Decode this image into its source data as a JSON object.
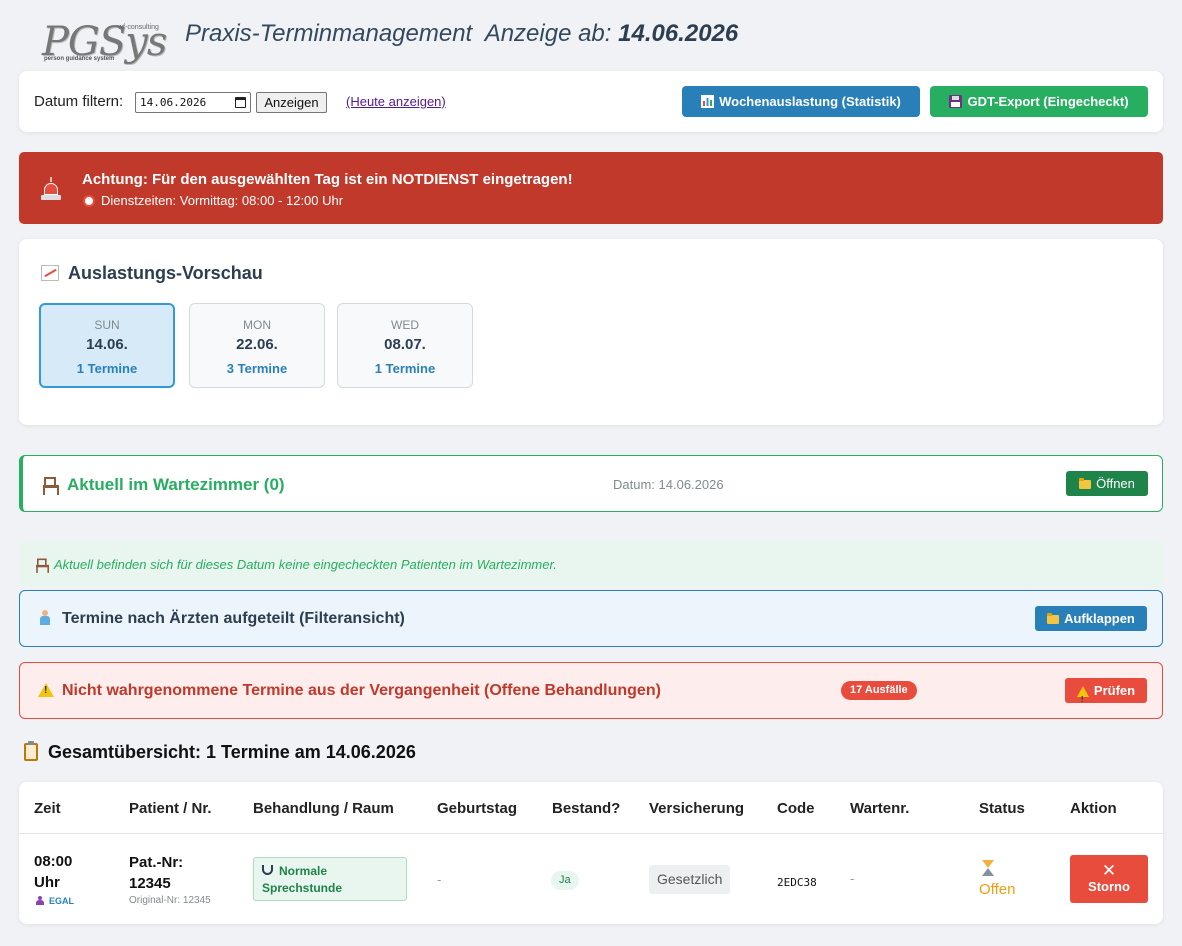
{
  "header": {
    "logo_text": "PGSys",
    "logo_top": "wf-consulting",
    "logo_sub": "person guidance system",
    "title": "Praxis-Terminmanagement",
    "title_prefix": "Anzeige ab:",
    "title_date": "14.06.2026"
  },
  "filter": {
    "label": "Datum filtern:",
    "date_value": "14.06.2026",
    "show_button": "Anzeigen",
    "today_link": "(Heute anzeigen)",
    "stats_button": "Wochenauslastung (Statistik)",
    "gdt_button": "GDT-Export (Eingecheckt)"
  },
  "alert": {
    "title": "Achtung: Für den ausgewählten Tag ist ein NOTDIENST eingetragen!",
    "subtitle": "Dienstzeiten: Vormittag: 08:00 - 12:00 Uhr",
    "color": "#c0392b"
  },
  "forecast": {
    "title": "Auslastungs-Vorschau",
    "days": [
      {
        "dow": "SUN",
        "date": "14.06.",
        "count": "1 Termine",
        "active": true
      },
      {
        "dow": "MON",
        "date": "22.06.",
        "count": "3 Termine",
        "active": false
      },
      {
        "dow": "WED",
        "date": "08.07.",
        "count": "1 Termine",
        "active": false
      }
    ]
  },
  "waiting": {
    "title": "Aktuell im Wartezimmer (0)",
    "date": "Datum: 14.06.2026",
    "open_button": "Öffnen",
    "empty_note": "Aktuell befinden sich für dieses Datum keine eingecheckten Patienten im Wartezimmer."
  },
  "doctors": {
    "title": "Termine nach Ärzten aufgeteilt (Filteransicht)",
    "expand_button": "Aufklappen"
  },
  "missed": {
    "title": "Nicht wahrgenommene Termine aus der Vergangenheit (Offene Behandlungen)",
    "badge": "17 Ausfälle",
    "check_button": "Prüfen"
  },
  "overview": {
    "title": "Gesamtübersicht: 1 Termine am 14.06.2026",
    "columns": [
      "Zeit",
      "Patient / Nr.",
      "Behandlung / Raum",
      "Geburtstag",
      "Bestand?",
      "Versicherung",
      "Code",
      "Wartenr.",
      "Status",
      "Aktion"
    ],
    "rows": [
      {
        "time": "08:00 Uhr",
        "doctor": "EGAL",
        "patient": "Pat.-Nr: 12345",
        "original": "Original-Nr: 12345",
        "treatment": "Normale Sprechstunde",
        "birthday": "-",
        "existing": "Ja",
        "insurance": "Gesetzlich",
        "code": "2EDC38",
        "wait_no": "-",
        "status": "Offen",
        "action": "Storno"
      }
    ]
  },
  "colors": {
    "primary": "#2980b9",
    "success": "#27ae60",
    "danger": "#e74c3c",
    "warning": "#f39c12"
  }
}
